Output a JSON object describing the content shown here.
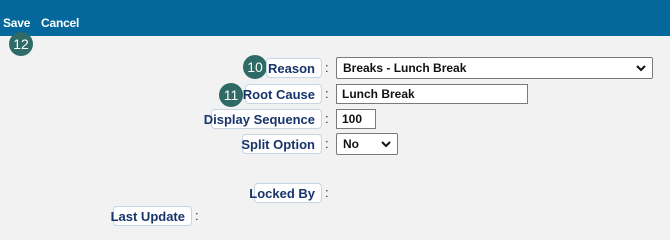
{
  "toolbar": {
    "save_label": "Save",
    "cancel_label": "Cancel",
    "save_badge": "12"
  },
  "form": {
    "reason": {
      "label": "Reason",
      "badge": "10",
      "selected": "Breaks - Lunch Break"
    },
    "root_cause": {
      "label": "Root Cause",
      "badge": "11",
      "value": "Lunch Break"
    },
    "display_sequence": {
      "label": "Display Sequence",
      "value": "100"
    },
    "split_option": {
      "label": "Split Option",
      "selected": "No"
    },
    "locked_by": {
      "label": "Locked By",
      "value": ""
    },
    "last_update": {
      "label": "Last Update",
      "value": ""
    },
    "colon": ":"
  },
  "colors": {
    "topbar": "#04689c",
    "badge": "#2f6b66",
    "label_text": "#17346b"
  }
}
